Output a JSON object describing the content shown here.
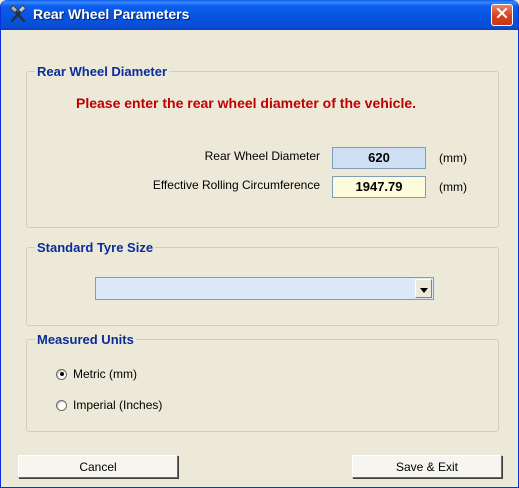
{
  "window": {
    "title": "Rear Wheel Parameters",
    "icon": "tools-icon",
    "close_icon": "close-icon"
  },
  "rear_wheel_diameter": {
    "legend": "Rear Wheel Diameter",
    "prompt": "Please enter the rear wheel diameter of the vehicle.",
    "diameter_label": "Rear Wheel Diameter",
    "diameter_value": "620",
    "diameter_unit": "(mm)",
    "circumference_label": "Effective Rolling Circumference",
    "circumference_value": "1947.79",
    "circumference_unit": "(mm)"
  },
  "standard_tyre_size": {
    "legend": "Standard Tyre Size",
    "selected": ""
  },
  "measured_units": {
    "legend": "Measured Units",
    "options": [
      {
        "label": "Metric (mm)",
        "checked": true
      },
      {
        "label": "Imperial (Inches)",
        "checked": false
      }
    ]
  },
  "buttons": {
    "cancel": "Cancel",
    "save_exit": "Save & Exit"
  },
  "colors": {
    "titlebar": "#0553e0",
    "prompt_text": "#c00000",
    "legend_text": "#0b2c99",
    "diameter_field_bg": "#cfe0f5",
    "circumference_field_bg": "#fcfcdc"
  }
}
